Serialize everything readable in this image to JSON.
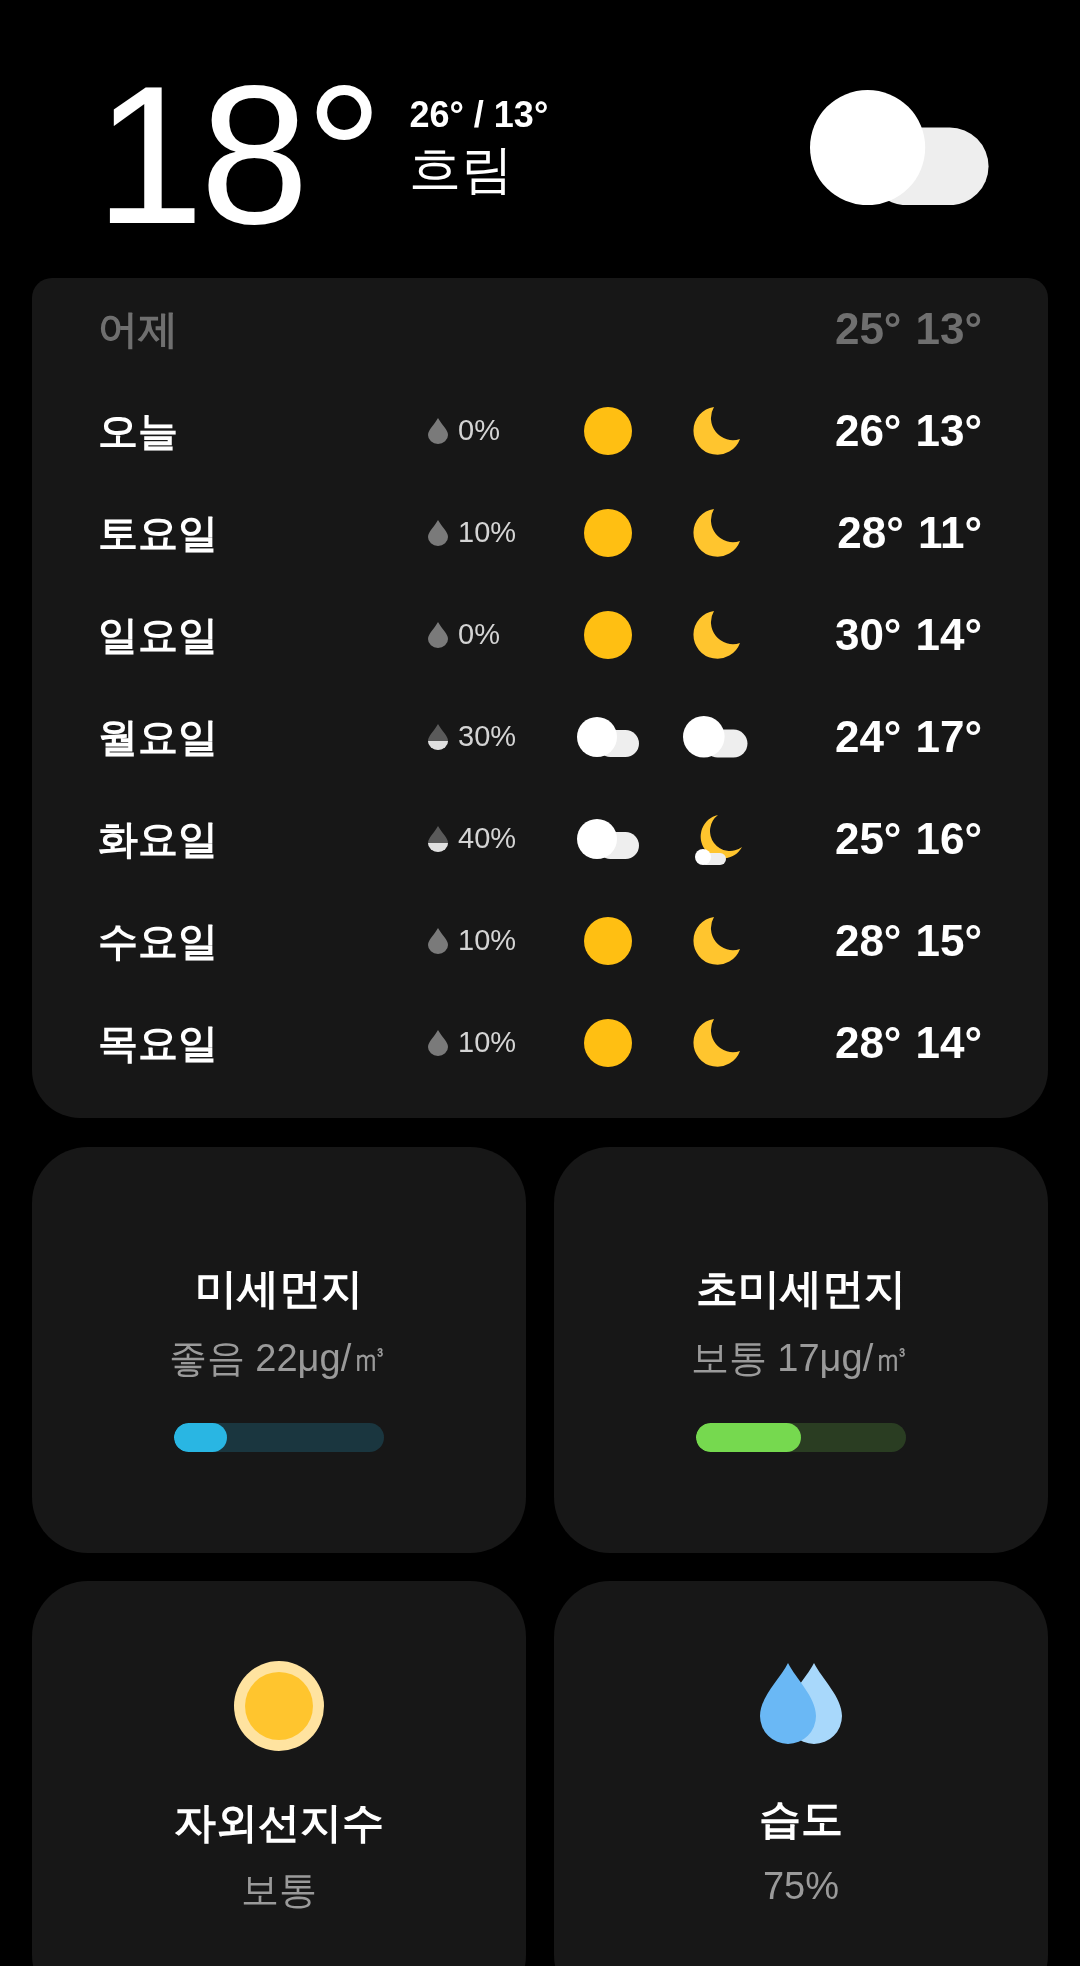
{
  "current": {
    "temperature": "18°",
    "high_low": "26° / 13°",
    "condition": "흐림",
    "icon": {
      "kind": "cloudy"
    }
  },
  "forecast": [
    {
      "day": "어제",
      "dimmed": true,
      "high": "25°",
      "low": "13°"
    },
    {
      "day": "오늘",
      "dimmed": false,
      "precip": "0%",
      "drop": {
        "kind": "full"
      },
      "day_icon": {
        "kind": "sun"
      },
      "night_icon": {
        "kind": "moon"
      },
      "high": "26°",
      "low": "13°"
    },
    {
      "day": "토요일",
      "dimmed": false,
      "precip": "10%",
      "drop": {
        "kind": "full"
      },
      "day_icon": {
        "kind": "sun"
      },
      "night_icon": {
        "kind": "moon"
      },
      "high": "28°",
      "low": "11°"
    },
    {
      "day": "일요일",
      "dimmed": false,
      "precip": "0%",
      "drop": {
        "kind": "full"
      },
      "day_icon": {
        "kind": "sun"
      },
      "night_icon": {
        "kind": "moon"
      },
      "high": "30°",
      "low": "14°"
    },
    {
      "day": "월요일",
      "dimmed": false,
      "precip": "30%",
      "drop": {
        "kind": "half"
      },
      "day_icon": {
        "kind": "cloudy"
      },
      "night_icon": {
        "kind": "cloudy"
      },
      "high": "24°",
      "low": "17°"
    },
    {
      "day": "화요일",
      "dimmed": false,
      "precip": "40%",
      "drop": {
        "kind": "half"
      },
      "day_icon": {
        "kind": "cloudy"
      },
      "night_icon": {
        "kind": "moon-cloud"
      },
      "high": "25°",
      "low": "16°"
    },
    {
      "day": "수요일",
      "dimmed": false,
      "precip": "10%",
      "drop": {
        "kind": "full"
      },
      "day_icon": {
        "kind": "sun"
      },
      "night_icon": {
        "kind": "moon"
      },
      "high": "28°",
      "low": "15°"
    },
    {
      "day": "목요일",
      "dimmed": false,
      "precip": "10%",
      "drop": {
        "kind": "full"
      },
      "day_icon": {
        "kind": "sun"
      },
      "night_icon": {
        "kind": "moon"
      },
      "high": "28°",
      "low": "14°"
    }
  ],
  "air_quality": [
    {
      "title": "미세먼지",
      "reading": "좋음 22μg/㎥",
      "level": 0.25,
      "color": "#29b6e3"
    },
    {
      "title": "초미세먼지",
      "reading": "보통 17μg/㎥",
      "level": 0.5,
      "color": "#76d94f"
    }
  ],
  "details": [
    {
      "kind": "uv",
      "title": "자외선지수",
      "value": "보통"
    },
    {
      "kind": "humidity",
      "title": "습도",
      "value": "75%"
    }
  ]
}
